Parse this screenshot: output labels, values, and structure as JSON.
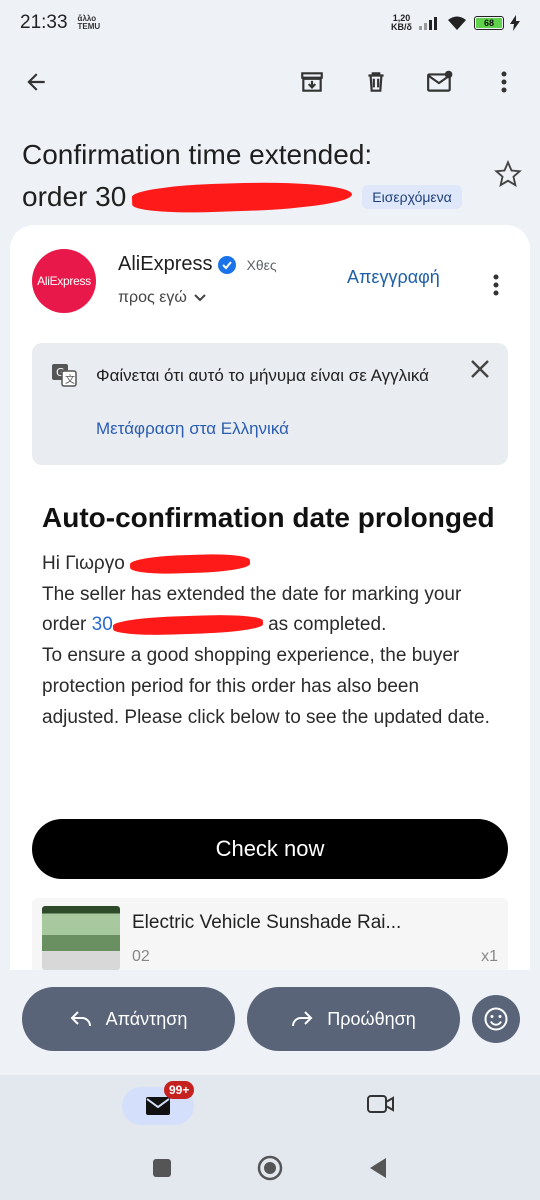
{
  "status_bar": {
    "time": "21:33",
    "mini_icon_text": "ἄλλο TEMU",
    "net_speed_top": "1,20",
    "net_speed_bottom": "KB/δ",
    "battery": "68"
  },
  "app_bar": {
    "icons": [
      "back-arrow-icon",
      "archive-icon",
      "delete-icon",
      "mark-unread-icon",
      "more-vert-icon"
    ]
  },
  "subject": {
    "line1": "Confirmation time extended:",
    "line2_prefix": "order 30",
    "label": "Εισερχόμενα"
  },
  "sender": {
    "avatar_text": "AliExpress",
    "name": "AliExpress",
    "time": "Χθες",
    "recipient": "προς εγώ",
    "unsubscribe": "Απεγγραφή",
    "avatar_color": "#e8194a"
  },
  "translate": {
    "message": "Φαίνεται ότι αυτό το μήνυμα είναι σε Αγγλικά",
    "link": "Μετάφραση στα Ελληνικά"
  },
  "email": {
    "headline": "Auto-confirmation date prolonged",
    "greeting": "Hi Γιωργο",
    "line1": "The seller has extended the date for marking your",
    "order_prefix": "order",
    "order_link_prefix": "30",
    "order_suffix": "as completed.",
    "line3": "To ensure a good shopping experience, the buyer protection period for this order has also been adjusted. Please click below to see the updated date.",
    "button": "Check now",
    "product_title": "Electric Vehicle Sunshade Rai...",
    "product_sub": "02",
    "product_qty": "x1"
  },
  "bottom_actions": {
    "reply": "Απάντηση",
    "forward": "Προώθηση"
  },
  "bottom_nav": {
    "mail_badge": "99+"
  }
}
